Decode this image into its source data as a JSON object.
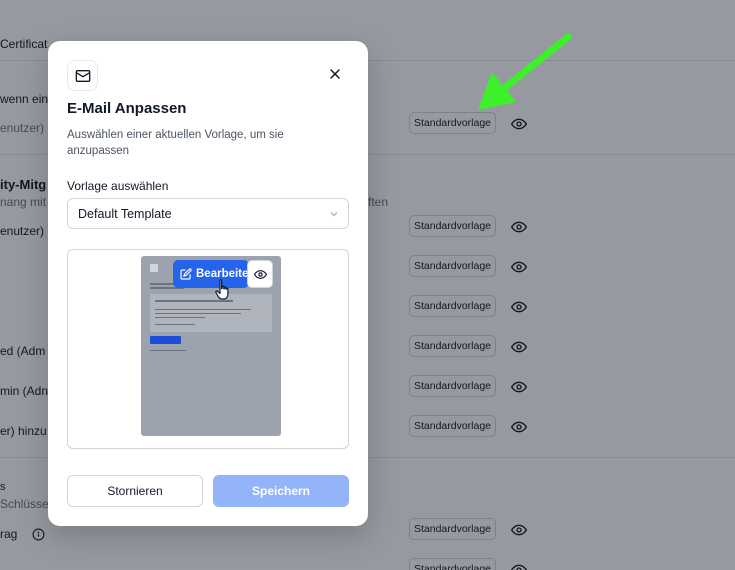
{
  "background": {
    "header_tab": "Certificat",
    "rows": [
      {
        "text": "wenn ein f"
      },
      {
        "text": "enutzer)"
      },
      {
        "section_title": "ity-Mitg"
      },
      {
        "section_sub": "nang mit e",
        "section_sub_right": "ften"
      },
      {
        "text": "enutzer)"
      },
      {
        "text": "ed (Adm"
      },
      {
        "text": "min (Adn"
      },
      {
        "text": "er) hinzu"
      },
      {
        "text": "s"
      },
      {
        "text": "Schlüssel"
      },
      {
        "text": "rag"
      }
    ],
    "pill_label": "Standardvorlage",
    "pill_count": 9
  },
  "modal": {
    "icon": "mail-icon",
    "title": "E-Mail Anpassen",
    "description": "Auswählen einer aktuellen Vorlage, um sie anzupassen",
    "field_label": "Vorlage auswählen",
    "selected_template": "Default Template",
    "preview": {
      "edit_label": "Bearbeiten",
      "view_icon": "eye-icon"
    },
    "cancel_label": "Stornieren",
    "save_label": "Speichern"
  },
  "colors": {
    "primary": "#2563eb",
    "primary_disabled": "#93b4f9",
    "arrow": "#3cf02a",
    "overlay": "#111827"
  }
}
